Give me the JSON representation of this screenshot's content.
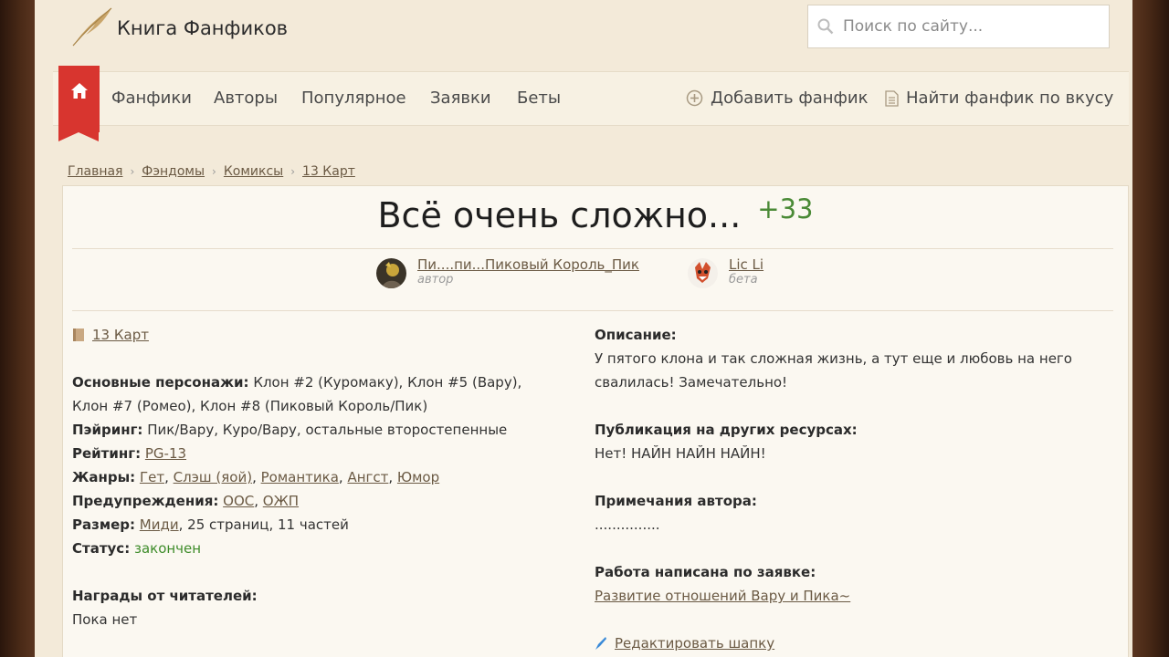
{
  "site": {
    "name": "Книга Фанфиков"
  },
  "search": {
    "placeholder": "Поиск по сайту..."
  },
  "nav": {
    "items": [
      {
        "label": "Фанфики"
      },
      {
        "label": "Авторы"
      },
      {
        "label": "Популярное"
      },
      {
        "label": "Заявки"
      },
      {
        "label": "Беты"
      }
    ],
    "add_fic": "Добавить фанфик",
    "find_fic": "Найти фанфик по вкусу"
  },
  "breadcrumb": [
    "Главная",
    "Фэндомы",
    "Комиксы",
    "13 Карт"
  ],
  "fic": {
    "title": "Всё очень сложно...",
    "rating_score": "+33",
    "author": {
      "name": "Пи....пи...Пиковый Король_Пик",
      "role": "автор"
    },
    "beta": {
      "name": "Lic Li",
      "role": "бета"
    },
    "fandom": "13 Карт",
    "characters_label": "Основные персонажи:",
    "characters_line1": "Клон #2 (Куромаку), Клон #5 (Вару),",
    "characters_line2": "Клон #7 (Ромео), Клон #8 (Пиковый Король/Пик)",
    "pairing_label": "Пэйринг:",
    "pairing": "Пик/Вару, Куро/Вару, остальные второстепенные",
    "rating_label": "Рейтинг:",
    "rating": "PG-13",
    "genres_label": "Жанры:",
    "genres": [
      "Гет",
      "Слэш (яой)",
      "Романтика",
      "Ангст",
      "Юмор"
    ],
    "warnings_label": "Предупреждения:",
    "warnings": [
      "ООС",
      "ОЖП"
    ],
    "size_label": "Размер:",
    "size_link": "Миди",
    "size_rest": ", 25 страниц, 11 частей",
    "status_label": "Статус:",
    "status": "закончен",
    "awards_label": "Награды от читателей:",
    "awards": "Пока нет",
    "description_label": "Описание:",
    "description_line1": "У пятого клона и так сложная жизнь, а тут еще и любовь на него",
    "description_line2": "свалилась! Замечательно!",
    "publication_label": "Публикация на других ресурсах:",
    "publication": "Нет! НАЙН НАЙН НАЙН!",
    "notes_label": "Примечания автора:",
    "notes": "...............",
    "request_label": "Работа написана по заявке:",
    "request": "Развитие отношений Вару и Пика~",
    "edit_header": "Редактировать шапку"
  },
  "colors": {
    "accent_red": "#d8352f",
    "link": "#6b5a44",
    "status_green": "#3e8c2a",
    "rating_green": "#4a8a36",
    "paper": "#f3ead9"
  }
}
